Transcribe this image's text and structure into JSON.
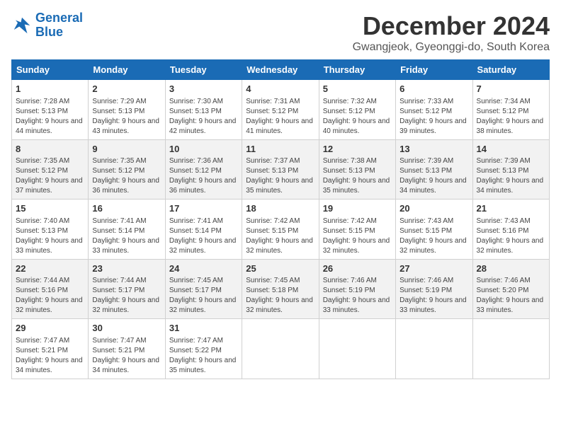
{
  "logo": {
    "line1": "General",
    "line2": "Blue"
  },
  "title": "December 2024",
  "subtitle": "Gwangjeok, Gyeonggi-do, South Korea",
  "weekdays": [
    "Sunday",
    "Monday",
    "Tuesday",
    "Wednesday",
    "Thursday",
    "Friday",
    "Saturday"
  ],
  "weeks": [
    [
      {
        "day": "1",
        "sunrise": "7:28 AM",
        "sunset": "5:13 PM",
        "daylight": "9 hours and 44 minutes."
      },
      {
        "day": "2",
        "sunrise": "7:29 AM",
        "sunset": "5:13 PM",
        "daylight": "9 hours and 43 minutes."
      },
      {
        "day": "3",
        "sunrise": "7:30 AM",
        "sunset": "5:13 PM",
        "daylight": "9 hours and 42 minutes."
      },
      {
        "day": "4",
        "sunrise": "7:31 AM",
        "sunset": "5:12 PM",
        "daylight": "9 hours and 41 minutes."
      },
      {
        "day": "5",
        "sunrise": "7:32 AM",
        "sunset": "5:12 PM",
        "daylight": "9 hours and 40 minutes."
      },
      {
        "day": "6",
        "sunrise": "7:33 AM",
        "sunset": "5:12 PM",
        "daylight": "9 hours and 39 minutes."
      },
      {
        "day": "7",
        "sunrise": "7:34 AM",
        "sunset": "5:12 PM",
        "daylight": "9 hours and 38 minutes."
      }
    ],
    [
      {
        "day": "8",
        "sunrise": "7:35 AM",
        "sunset": "5:12 PM",
        "daylight": "9 hours and 37 minutes."
      },
      {
        "day": "9",
        "sunrise": "7:35 AM",
        "sunset": "5:12 PM",
        "daylight": "9 hours and 36 minutes."
      },
      {
        "day": "10",
        "sunrise": "7:36 AM",
        "sunset": "5:12 PM",
        "daylight": "9 hours and 36 minutes."
      },
      {
        "day": "11",
        "sunrise": "7:37 AM",
        "sunset": "5:13 PM",
        "daylight": "9 hours and 35 minutes."
      },
      {
        "day": "12",
        "sunrise": "7:38 AM",
        "sunset": "5:13 PM",
        "daylight": "9 hours and 35 minutes."
      },
      {
        "day": "13",
        "sunrise": "7:39 AM",
        "sunset": "5:13 PM",
        "daylight": "9 hours and 34 minutes."
      },
      {
        "day": "14",
        "sunrise": "7:39 AM",
        "sunset": "5:13 PM",
        "daylight": "9 hours and 34 minutes."
      }
    ],
    [
      {
        "day": "15",
        "sunrise": "7:40 AM",
        "sunset": "5:13 PM",
        "daylight": "9 hours and 33 minutes."
      },
      {
        "day": "16",
        "sunrise": "7:41 AM",
        "sunset": "5:14 PM",
        "daylight": "9 hours and 33 minutes."
      },
      {
        "day": "17",
        "sunrise": "7:41 AM",
        "sunset": "5:14 PM",
        "daylight": "9 hours and 32 minutes."
      },
      {
        "day": "18",
        "sunrise": "7:42 AM",
        "sunset": "5:15 PM",
        "daylight": "9 hours and 32 minutes."
      },
      {
        "day": "19",
        "sunrise": "7:42 AM",
        "sunset": "5:15 PM",
        "daylight": "9 hours and 32 minutes."
      },
      {
        "day": "20",
        "sunrise": "7:43 AM",
        "sunset": "5:15 PM",
        "daylight": "9 hours and 32 minutes."
      },
      {
        "day": "21",
        "sunrise": "7:43 AM",
        "sunset": "5:16 PM",
        "daylight": "9 hours and 32 minutes."
      }
    ],
    [
      {
        "day": "22",
        "sunrise": "7:44 AM",
        "sunset": "5:16 PM",
        "daylight": "9 hours and 32 minutes."
      },
      {
        "day": "23",
        "sunrise": "7:44 AM",
        "sunset": "5:17 PM",
        "daylight": "9 hours and 32 minutes."
      },
      {
        "day": "24",
        "sunrise": "7:45 AM",
        "sunset": "5:17 PM",
        "daylight": "9 hours and 32 minutes."
      },
      {
        "day": "25",
        "sunrise": "7:45 AM",
        "sunset": "5:18 PM",
        "daylight": "9 hours and 32 minutes."
      },
      {
        "day": "26",
        "sunrise": "7:46 AM",
        "sunset": "5:19 PM",
        "daylight": "9 hours and 33 minutes."
      },
      {
        "day": "27",
        "sunrise": "7:46 AM",
        "sunset": "5:19 PM",
        "daylight": "9 hours and 33 minutes."
      },
      {
        "day": "28",
        "sunrise": "7:46 AM",
        "sunset": "5:20 PM",
        "daylight": "9 hours and 33 minutes."
      }
    ],
    [
      {
        "day": "29",
        "sunrise": "7:47 AM",
        "sunset": "5:21 PM",
        "daylight": "9 hours and 34 minutes."
      },
      {
        "day": "30",
        "sunrise": "7:47 AM",
        "sunset": "5:21 PM",
        "daylight": "9 hours and 34 minutes."
      },
      {
        "day": "31",
        "sunrise": "7:47 AM",
        "sunset": "5:22 PM",
        "daylight": "9 hours and 35 minutes."
      },
      null,
      null,
      null,
      null
    ]
  ],
  "labels": {
    "sunrise": "Sunrise:",
    "sunset": "Sunset:",
    "daylight": "Daylight:"
  }
}
